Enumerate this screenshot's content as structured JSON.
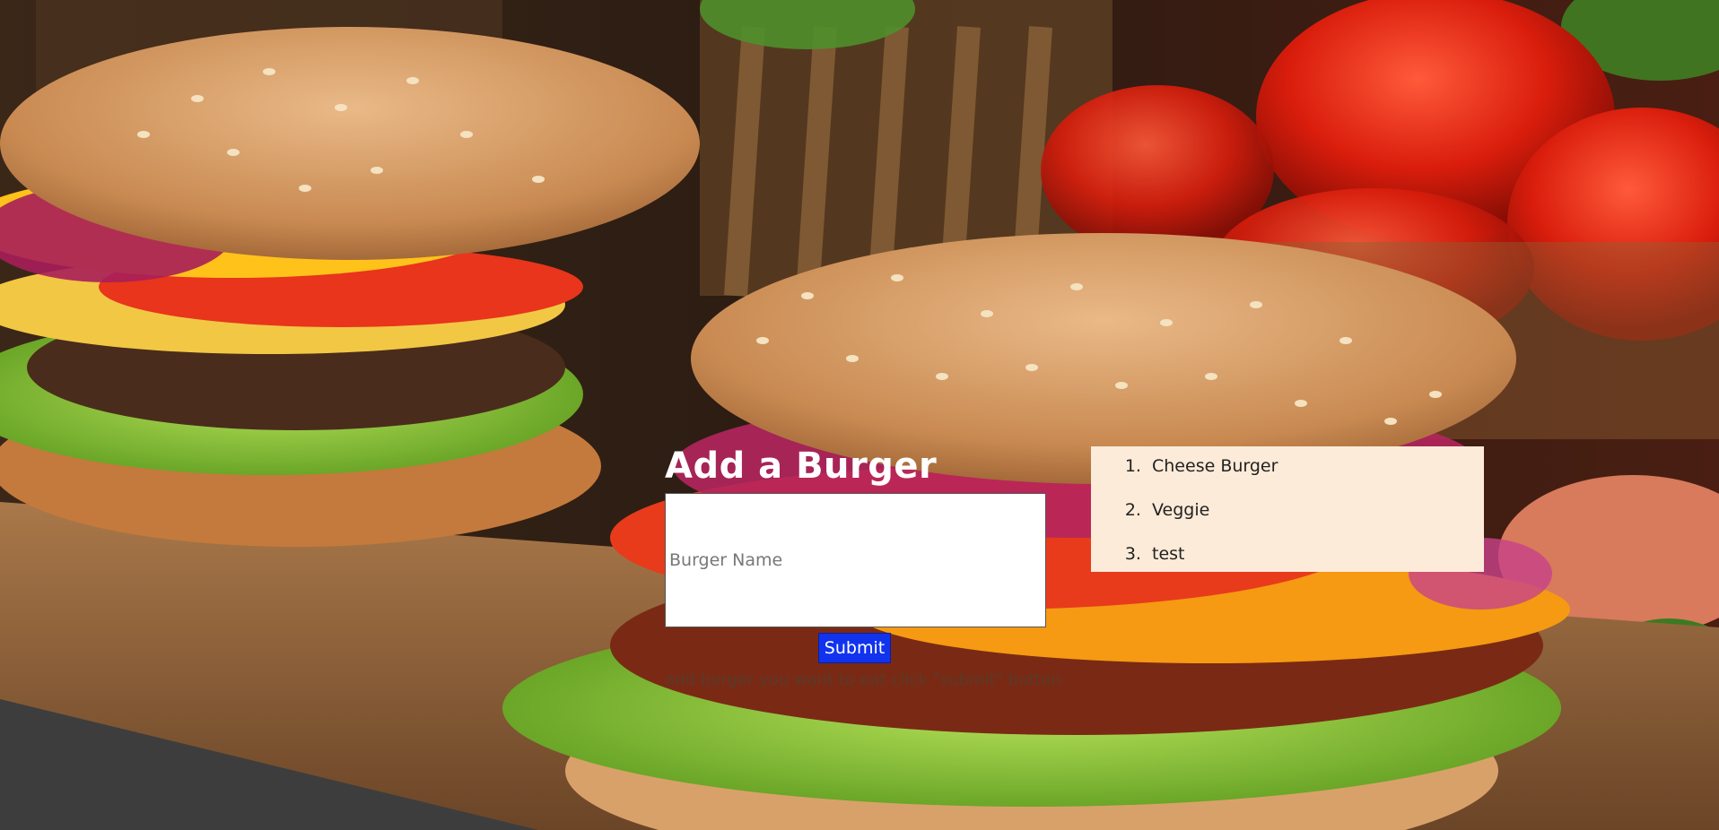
{
  "form": {
    "title": "Add a Burger",
    "input_placeholder": "Burger Name",
    "input_value": "",
    "submit_label": "Submit",
    "help_text": "add burger you want to eat click \"submit\" button"
  },
  "burgers": [
    {
      "name": "Cheese Burger"
    },
    {
      "name": "Veggie"
    },
    {
      "name": "test"
    }
  ],
  "colors": {
    "submit_bg": "#1133ee",
    "list_bg": "#fcebd8"
  }
}
